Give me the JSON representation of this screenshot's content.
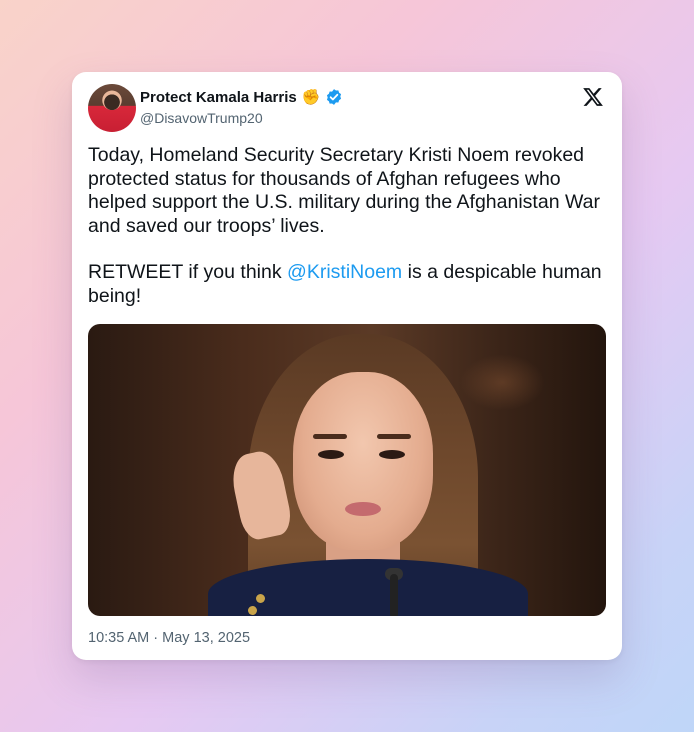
{
  "tweet": {
    "author_name": "Protect Kamala Harris",
    "author_emoji": "✊",
    "handle": "@DisavowTrump20",
    "paragraph1": "Today, Homeland Security Secretary Kristi Noem revoked protected status for thousands of Afghan refugees who helped support the U.S. military during the Afghanistan War and saved our troops’ lives.",
    "paragraph2_before": "RETWEET if you think ",
    "mention": "@KristiNoem",
    "paragraph2_after": " is a despicable human being!",
    "timestamp": "10:35 AM · May 13, 2025"
  },
  "icons": {
    "verified": "verified-badge-icon",
    "platform": "x-logo-icon"
  },
  "colors": {
    "accent": "#1d9bf0",
    "text": "#0f1419",
    "muted": "#536471"
  }
}
